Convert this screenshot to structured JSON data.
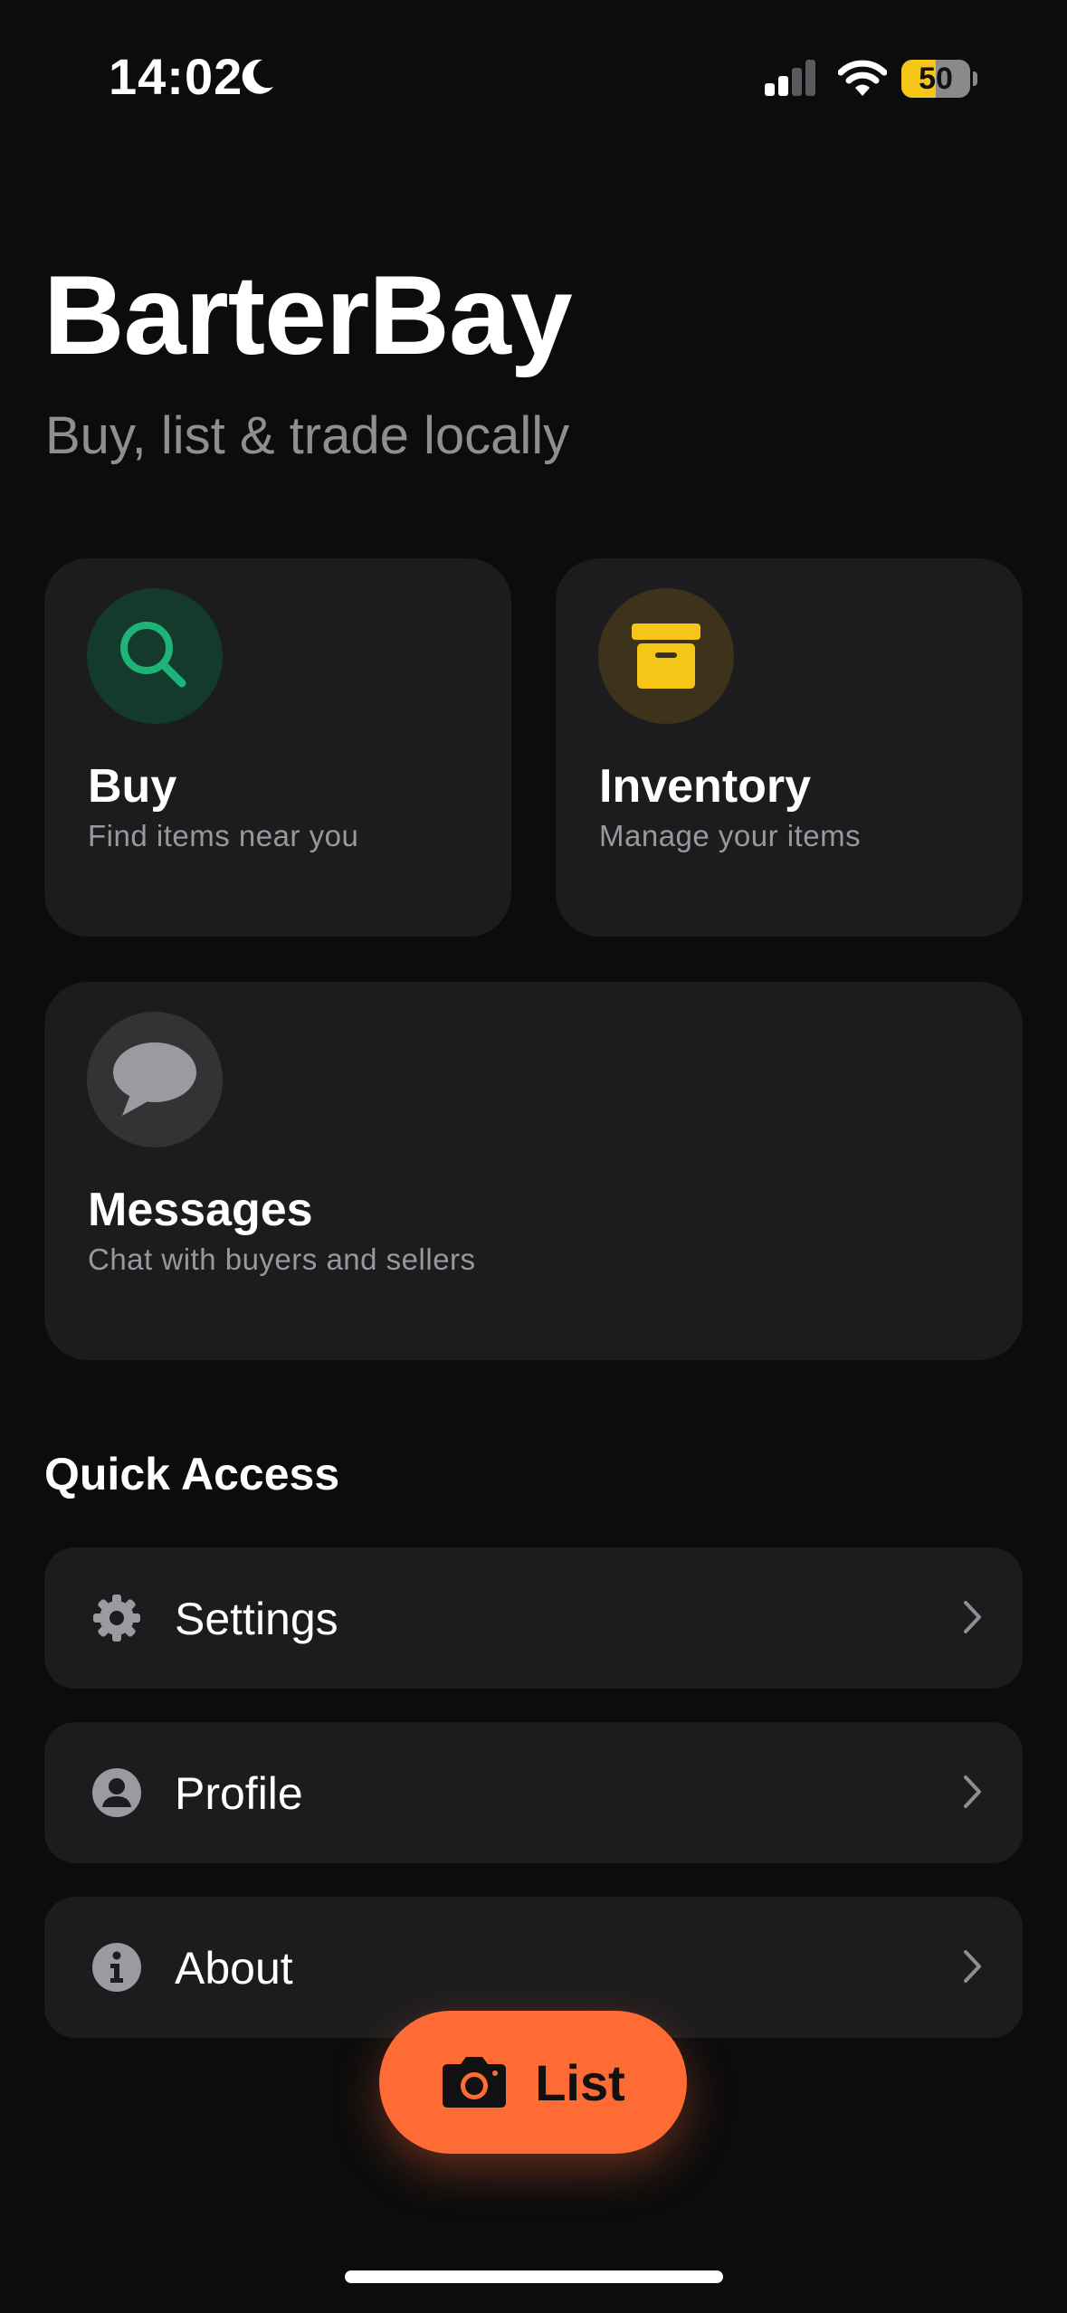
{
  "status_bar": {
    "time": "14:02",
    "battery_percent": "50",
    "battery_level": 0.5,
    "signal_bars_active": 2,
    "signal_bars_total": 4
  },
  "app": {
    "title": "BarterBay",
    "subtitle": "Buy, list & trade locally"
  },
  "cards": [
    {
      "title": "Buy",
      "subtitle": "Find items near you",
      "icon": "search-icon",
      "accent": "#1fb37a"
    },
    {
      "title": "Inventory",
      "subtitle": "Manage your items",
      "icon": "archive-box-icon",
      "accent": "#f5c518"
    },
    {
      "title": "Messages",
      "subtitle": "Chat with buyers and sellers",
      "icon": "chat-bubble-icon",
      "accent": "#9a9a9f"
    }
  ],
  "quick_access": {
    "title": "Quick Access",
    "items": [
      {
        "label": "Settings",
        "icon": "gear-icon"
      },
      {
        "label": "Profile",
        "icon": "person-circle-icon"
      },
      {
        "label": "About",
        "icon": "info-icon"
      }
    ]
  },
  "fab": {
    "label": "List",
    "icon": "camera-icon",
    "color": "#ff6b35"
  }
}
